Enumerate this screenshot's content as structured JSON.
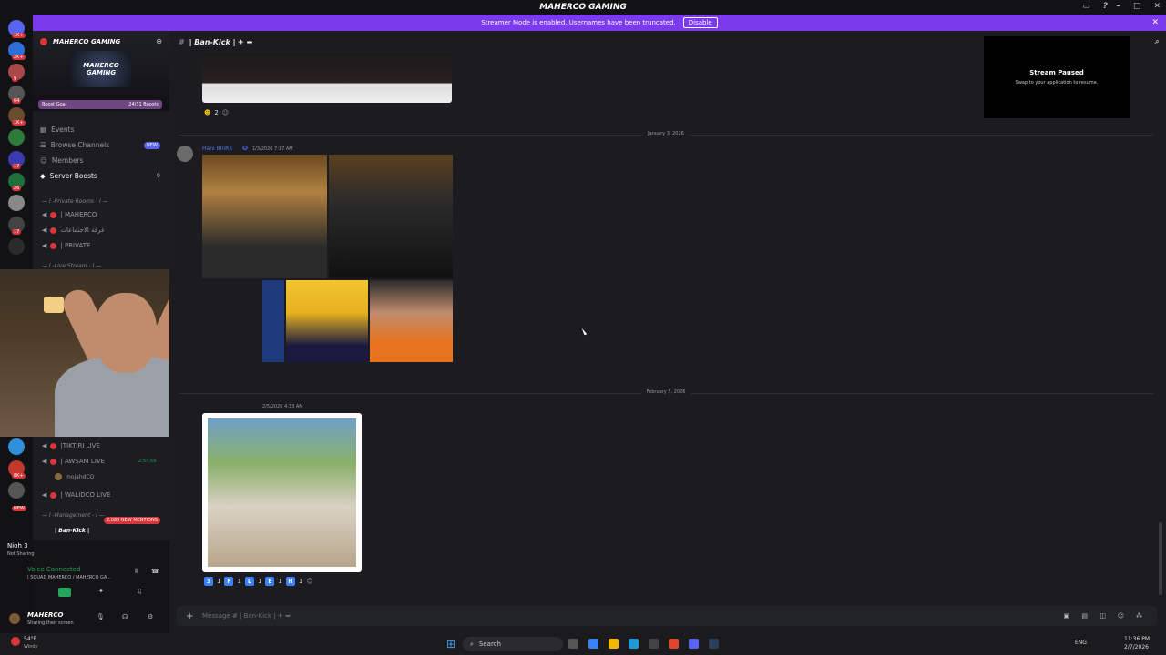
{
  "window": {
    "title": "MAHERCO GAMING"
  },
  "banner": {
    "text": "Streamer Mode is enabled. Usernames have been truncated.",
    "disable_label": "Disable"
  },
  "guild_badges": [
    "1K+",
    "2K+",
    "9",
    "64",
    "1K+",
    "17",
    "26",
    "17",
    "8K+",
    "NEW"
  ],
  "server": {
    "name": "MAHERCO GAMING",
    "logo_text": "MAHERCO GAMING",
    "boost_goal_label": "Boost Goal",
    "boost_count": "24/31 Boosts"
  },
  "nav": {
    "events": "Events",
    "browse_channels": "Browse Channels",
    "new_badge": "NEW",
    "members": "Members",
    "server_boosts": "Server Boosts",
    "server_boosts_count": "9"
  },
  "categories": {
    "private_rooms": "— l -Private Rooms - l —",
    "live_stream": "— l -Live Stream - l —",
    "management": "— l -Management - l —"
  },
  "channels": {
    "maherco": "| MAHERCO",
    "arabic_room": "غرفة الاجتماعات",
    "private": "| PRIVATE",
    "tiktiri": "|TIKTIRI LIVE",
    "awsam": "| AWSAM LIVE",
    "awsam_timer": "2:57:59",
    "awsam_user": "mojahdCO",
    "walidco": "| WALIDCO LIVE"
  },
  "mentions_badge": "2,089 NEW MENTIONS",
  "voice": {
    "current_channel": "| Ban-Kick |",
    "game": "Nioh 3",
    "game_status": "Not Sharing",
    "connected": "Voice Connected",
    "connected_detail": "| SQUAD MAHERCO / MAHERCO GA..."
  },
  "user": {
    "name": "MAHERCO",
    "status": "Sharing their screen"
  },
  "chat": {
    "channel_name": "| Ban-Kick | ✈ ➡",
    "reaction_count_1": "2",
    "date_1": "January 3, 2026",
    "author_2": "Hani BinRK",
    "time_2": "1/3/2026 7:17 AM",
    "date_2": "February 5, 2026",
    "time_3": "2/5/2026 4:33 AM",
    "reactions_3": [
      {
        "letter": "3",
        "count": "1"
      },
      {
        "letter": "F",
        "count": "1"
      },
      {
        "letter": "L",
        "count": "1"
      },
      {
        "letter": "E",
        "count": "1"
      },
      {
        "letter": "H",
        "count": "1"
      }
    ],
    "composer_placeholder": "Message # | Ban-Kick | ✈ ➡"
  },
  "stream_paused": {
    "title": "Stream Paused",
    "subtitle": "Swap to your application to resume."
  },
  "taskbar": {
    "weather_temp": "54°F",
    "weather_desc": "Windy",
    "search_label": "Search",
    "lang": "ENG",
    "time": "11:36 PM",
    "date": "2/7/2026"
  },
  "colors": {
    "banner": "#7c3aed",
    "accent": "#5865f2",
    "badge": "#d8363b",
    "voice_green": "#23a55a"
  }
}
